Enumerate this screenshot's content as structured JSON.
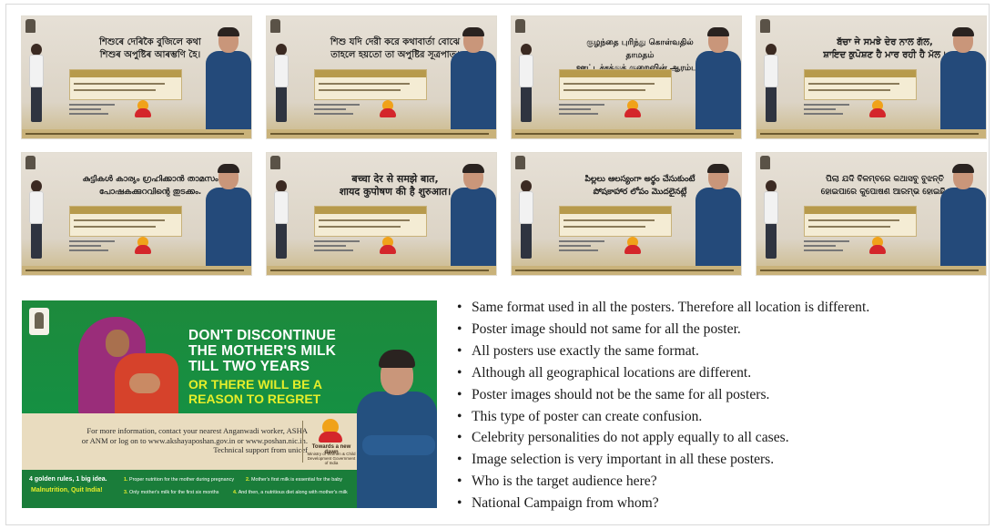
{
  "posters": [
    {
      "headline": "শিশুৰে দেৰিকৈ বুজিলে কথা\nশিশুৰ অপুষ্টিৰ আৰম্ভণি হৈ।",
      "headline_color": "#1f1f1f"
    },
    {
      "headline": "শিশু যদি দেরী করে কথাবার্তা বোঝে\nতাহলে হয়তো তা অপুষ্টির সূত্রপাত।",
      "headline_color": "#1f1f1f"
    },
    {
      "headline": "குழந்தை புரிந்து கொள்வதில் தாமதம்\nஊட்டச்சத்துக் குறைவின் ஆரம்பம்",
      "headline_color": "#1f1f1f"
    },
    {
      "headline": "ਬੱਚਾ ਜੇ ਸਮਝੇ ਦੇਰ ਨਾਲ ਗੱਲ,\nਸ਼ਾਇਦ ਕੁਪੋਸ਼ਣ ਹੈ ਮਾਰ ਰਹੀ ਹੈ ਮੱਲ।",
      "headline_color": "#1f1f1f"
    },
    {
      "headline": "കുട്ടികൾ കാര്യം ഗ്രഹിക്കാൻ താമസം\nപോഷകക്കുറവിന്റെ തുടക്കം.",
      "headline_color": "#1f1f1f"
    },
    {
      "headline": "बच्चा देर से समझे बात,\nशायद कुपोषण की है शुरुआत।",
      "headline_color": "#1f1f1f"
    },
    {
      "headline": "పిల్లలు ఆలస్యంగా అర్థం చేసుకుంటే\nపోషకాహార లోపం మొదలైనట్లే",
      "headline_color": "#1f1f1f"
    },
    {
      "headline": "ପିଲା ଯଦି ବିଳମ୍ବରେ କଥାସବୁ ବୁଝନ୍ତି\nହୋଇପାରେ କୁପୋଷଣ ଆରମ୍ଭ ହୋଇଛି।",
      "headline_color": "#1f1f1f"
    }
  ],
  "big_poster": {
    "headline": "DON'T DISCONTINUE THE MOTHER'S MILK TILL TWO YEARS",
    "subheadline": "OR THERE WILL BE A REASON TO REGRET",
    "info": "For more information, contact your nearest Anganwadi worker, ASHA or ANM or log on to www.akshayaposhan.gov.in or www.poshan.nic.in. Technical support from unicef",
    "logo_title": "Towards a new dawn",
    "logo_sub": "Ministry of Women & Child Development Government of India",
    "tagline": "4 golden rules, 1 big idea.",
    "tagline2": "Malnutrition, Quit India!",
    "rules": [
      {
        "num": "1.",
        "text": "Proper nutrition for the mother during pregnancy"
      },
      {
        "num": "2.",
        "text": "Mother's first milk is essential for the baby"
      },
      {
        "num": "3.",
        "text": "Only mother's milk for the first six months"
      },
      {
        "num": "4.",
        "text": "And then, a nutritious diet along with mother's milk"
      }
    ],
    "colors": {
      "green": "#159043",
      "yellow": "#e5ee2a",
      "band": "#e9dcbf"
    }
  },
  "bullets": [
    "Same format used in all the posters. Therefore all location is different.",
    "Poster image should not same for all the poster.",
    "All posters use exactly the same format.",
    "Although all geographical locations are different.",
    "Poster images should not be the same for all posters.",
    "This type of poster can create confusion.",
    "Celebrity personalities do not apply equally to all cases.",
    "Image selection is very important in all these posters.",
    "Who is the target audience here?",
    "National Campaign from whom?"
  ]
}
